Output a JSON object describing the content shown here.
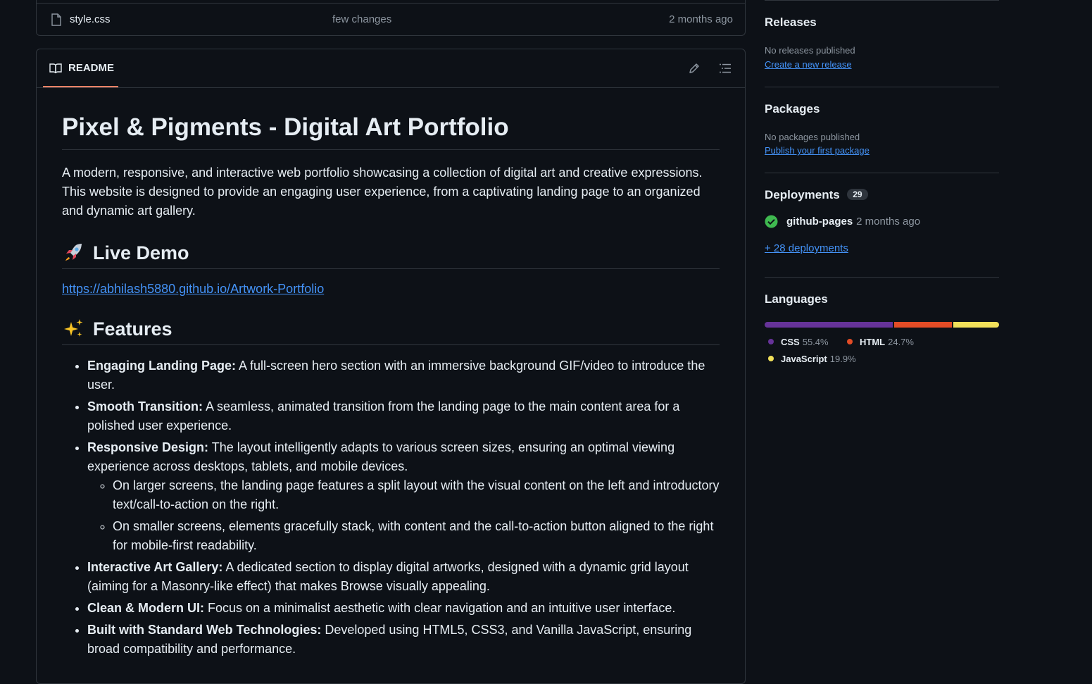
{
  "file": {
    "name": "style.css",
    "message": "few changes",
    "time": "2 months ago"
  },
  "readme": {
    "tab_label": "README",
    "title": "Pixel & Pigments - Digital Art Portfolio",
    "intro": "A modern, responsive, and interactive web portfolio showcasing a collection of digital art and creative expressions. This website is designed to provide an engaging user experience, from a captivating landing page to an organized and dynamic art gallery.",
    "demo_heading": "Live Demo",
    "demo_link": "https://abhilash5880.github.io/Artwork-Portfolio",
    "features_heading": "Features",
    "features": [
      {
        "title": "Engaging Landing Page:",
        "text": " A full-screen hero section with an immersive background GIF/video to introduce the user."
      },
      {
        "title": "Smooth Transition:",
        "text": " A seamless, animated transition from the landing page to the main content area for a polished user experience."
      },
      {
        "title": "Responsive Design:",
        "text": " The layout intelligently adapts to various screen sizes, ensuring an optimal viewing experience across desktops, tablets, and mobile devices."
      },
      {
        "title": "Interactive Art Gallery:",
        "text": " A dedicated section to display digital artworks, designed with a dynamic grid layout (aiming for a Masonry-like effect) that makes Browse visually appealing."
      },
      {
        "title": "Clean & Modern UI:",
        "text": " Focus on a minimalist aesthetic with clear navigation and an intuitive user interface."
      },
      {
        "title": "Built with Standard Web Technologies:",
        "text": " Developed using HTML5, CSS3, and Vanilla JavaScript, ensuring broad compatibility and performance."
      }
    ],
    "responsive_sub": [
      "On larger screens, the landing page features a split layout with the visual content on the left and introductory text/call-to-action on the right.",
      "On smaller screens, elements gracefully stack, with content and the call-to-action button aligned to the right for mobile-first readability."
    ]
  },
  "sidebar": {
    "releases": {
      "heading": "Releases",
      "empty": "No releases published",
      "link": "Create a new release"
    },
    "packages": {
      "heading": "Packages",
      "empty": "No packages published",
      "link": "Publish your first package"
    },
    "deployments": {
      "heading": "Deployments",
      "count": "29",
      "env": "github-pages",
      "time": "2 months ago",
      "more": "+ 28 deployments"
    },
    "languages": {
      "heading": "Languages",
      "items": [
        {
          "name": "CSS",
          "percent": "55.4%",
          "value": 55.4,
          "color": "#663399"
        },
        {
          "name": "HTML",
          "percent": "24.7%",
          "value": 24.7,
          "color": "#e34c26"
        },
        {
          "name": "JavaScript",
          "percent": "19.9%",
          "value": 19.9,
          "color": "#f1e05a"
        }
      ]
    }
  }
}
